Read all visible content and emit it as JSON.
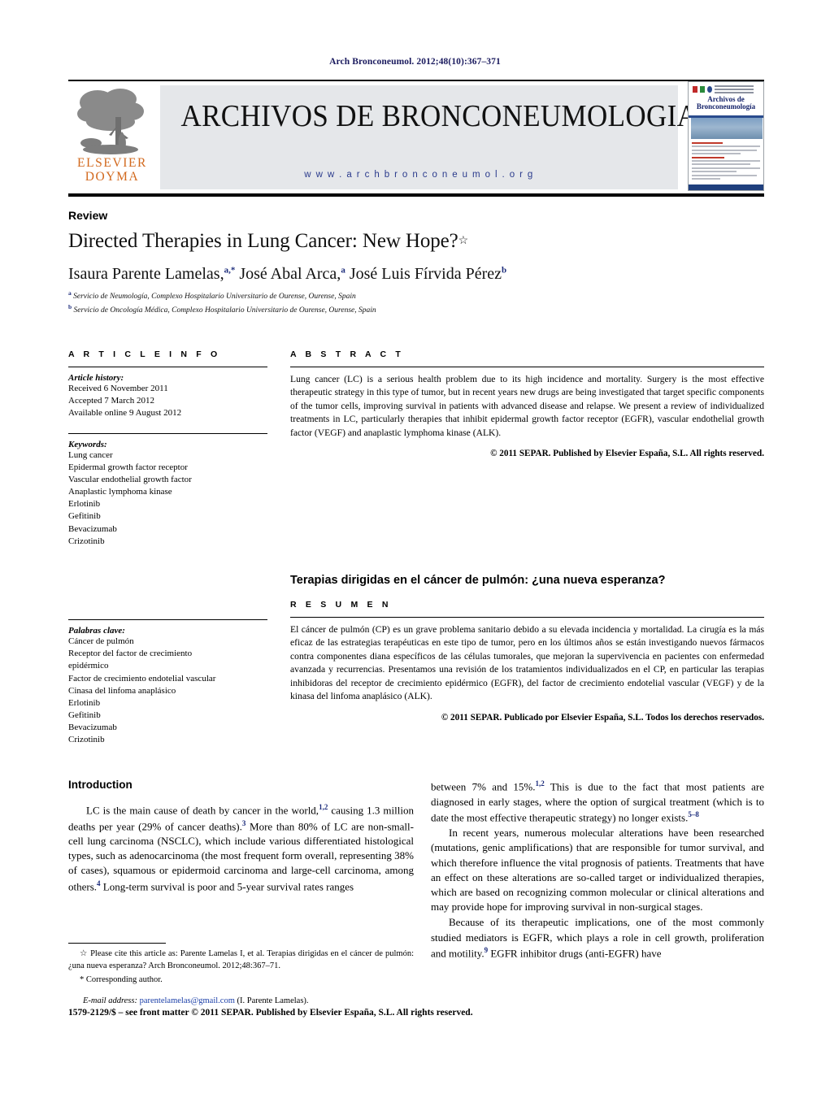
{
  "running_head": "Arch Bronconeumol. 2012;48(10):367–371",
  "masthead": {
    "publisher_line1": "ELSEVIER",
    "publisher_line2": "DOYMA",
    "journal_title": "ARCHIVOS DE BRONCONEUMOLOGIA",
    "journal_url": "w w w . a r c h b r o n c o n e u m o l . o r g",
    "cover_title_line1": "Archivos de",
    "cover_title_line2": "Bronconeumología"
  },
  "article": {
    "section": "Review",
    "title": "Directed Therapies in Lung Cancer: New Hope?",
    "title_marker": "☆",
    "authors_html": "Isaura Parente Lamelas,<sup>a,</sup><sup>*</sup> José Abal Arca,<sup>a</sup> José Luis Fírvida Pérez<sup>b</sup>",
    "affiliation_a": "Servicio de Neumología, Complexo Hospitalario Universitario de Ourense, Ourense, Spain",
    "affiliation_b": "Servicio de Oncología Médica, Complexo Hospitalario Universitario de Ourense, Ourense, Spain"
  },
  "article_info": {
    "label": "A R T I C L E   I N F O",
    "history_heading": "Article history:",
    "history": [
      "Received 6 November 2011",
      "Accepted 7 March 2012",
      "Available online 9 August 2012"
    ],
    "keywords_heading": "Keywords:",
    "keywords": [
      "Lung cancer",
      "Epidermal growth factor receptor",
      "Vascular endothelial growth factor",
      "Anaplastic lymphoma kinase",
      "Erlotinib",
      "Gefitinib",
      "Bevacizumab",
      "Crizotinib"
    ],
    "palabras_heading": "Palabras clave:",
    "palabras": [
      "Cáncer de pulmón",
      "Receptor del factor de crecimiento",
      "epidérmico",
      "Factor de crecimiento endotelial vascular",
      "Cinasa del linfoma anaplásico",
      "Erlotinib",
      "Gefitinib",
      "Bevacizumab",
      "Crizotinib"
    ]
  },
  "abstract": {
    "label": "A B S T R A C T",
    "text": "Lung cancer (LC) is a serious health problem due to its high incidence and mortality. Surgery is the most effective therapeutic strategy in this type of tumor, but in recent years new drugs are being investigated that target specific components of the tumor cells, improving survival in patients with advanced disease and relapse. We present a review of individualized treatments in LC, particularly therapies that inhibit epidermal growth factor receptor (EGFR), vascular endothelial growth factor (VEGF) and anaplastic lymphoma kinase (ALK).",
    "copyright": "© 2011 SEPAR. Published by Elsevier España, S.L. All rights reserved."
  },
  "resumen": {
    "spanish_title": "Terapias dirigidas en el cáncer de pulmón: ¿una nueva esperanza?",
    "label": "R E S U M E N",
    "text": "El cáncer de pulmón (CP) es un grave problema sanitario debido a su elevada incidencia y mortalidad. La cirugía es la más eficaz de las estrategias terapéuticas en este tipo de tumor, pero en los últimos años se están investigando nuevos fármacos contra componentes diana específicos de las células tumorales, que mejoran la supervivencia en pacientes con enfermedad avanzada y recurrencias. Presentamos una revisión de los tratamientos individualizados en el CP, en particular las terapias inhibidoras del receptor de crecimiento epidérmico (EGFR), del factor de crecimiento endotelial vascular (VEGF) y de la kinasa del linfoma anaplásico (ALK).",
    "copyright": "© 2011 SEPAR. Publicado por Elsevier España, S.L. Todos los derechos reservados."
  },
  "body": {
    "intro_heading": "Introduction",
    "left_para_1": "LC is the main cause of death by cancer in the world,<sup>1,2</sup> causing 1.3 million deaths per year (29% of cancer deaths).<sup>3</sup> More than 80% of LC are non-small-cell lung carcinoma (NSCLC), which include various differentiated histological types, such as adenocarcinoma (the most frequent form overall, representing 38% of cases), squamous or epidermoid carcinoma and large-cell carcinoma, among others.<sup>4</sup> Long-term survival is poor and 5-year survival rates ranges",
    "right_para_1": "between 7% and 15%.<sup>1,2</sup> This is due to the fact that most patients are diagnosed in early stages, where the option of surgical treatment (which is to date the most effective therapeutic strategy) no longer exists.<sup>5–8</sup>",
    "right_para_2": "In recent years, numerous molecular alterations have been researched (mutations, genic amplifications) that are responsible for tumor survival, and which therefore influence the vital prognosis of patients. Treatments that have an effect on these alterations are so-called target or individualized therapies, which are based on recognizing common molecular or clinical alterations and may provide hope for improving survival in non-surgical stages.",
    "right_para_3": "Because of its therapeutic implications, one of the most commonly studied mediators is EGFR, which plays a role in cell growth, proliferation and motility.<sup>9</sup> EGFR inhibitor drugs (anti-EGFR) have"
  },
  "footnotes": {
    "cite_marker": "☆",
    "cite_text": "Please cite this article as: Parente Lamelas I, et al. Terapias dirigidas en el cáncer de pulmón: ¿una nueva esperanza? Arch Bronconeumol. 2012;48:367–71.",
    "corresponding_marker": "*",
    "corresponding_text": "Corresponding author.",
    "email_label": "E-mail address:",
    "email": "parentelamelas@gmail.com",
    "email_suffix": "(I. Parente Lamelas).",
    "front_matter": "1579-2129/$ – see front matter © 2011 SEPAR. Published by Elsevier España, S.L. All rights reserved."
  },
  "colors": {
    "running_head": "#1a1a5e",
    "link": "#1a3ea8",
    "banner_bg": "#e5e7ea",
    "elsevier_orange": "#d2691e",
    "superscript": "#1a2a7a"
  }
}
